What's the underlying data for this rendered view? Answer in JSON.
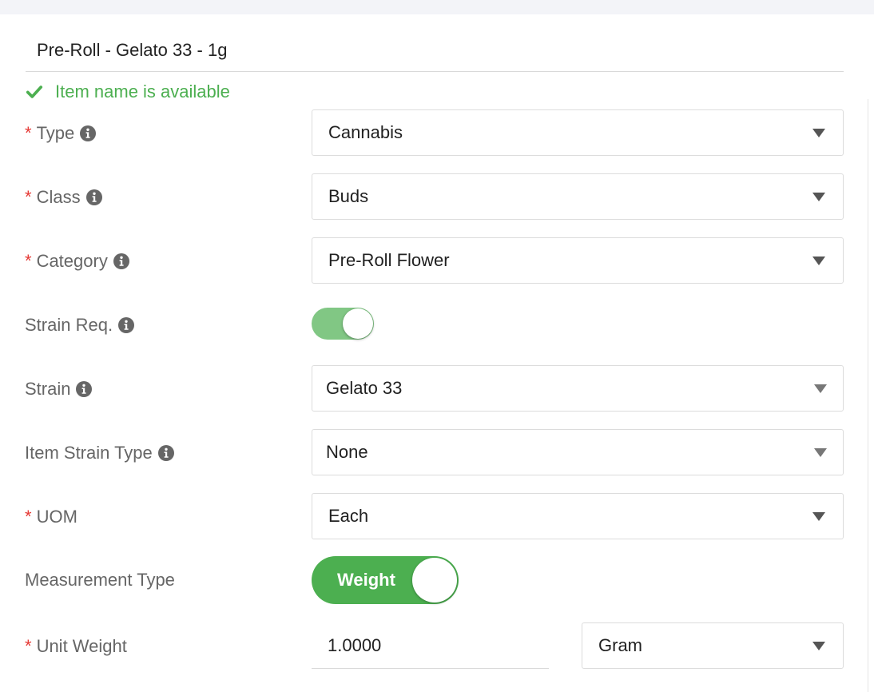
{
  "item_name": {
    "value": "Pre-Roll - Gelato 33 - 1g"
  },
  "availability": {
    "text": "Item name is available",
    "color": "#4caf50"
  },
  "fields": {
    "type": {
      "label": "Type",
      "required": "*",
      "value": "Cannabis"
    },
    "class": {
      "label": "Class",
      "required": "*",
      "value": "Buds"
    },
    "category": {
      "label": "Category",
      "required": "*",
      "value": "Pre-Roll Flower"
    },
    "strain_req": {
      "label": "Strain Req.",
      "toggle_on": true
    },
    "strain": {
      "label": "Strain",
      "value": "Gelato 33"
    },
    "item_strain_type": {
      "label": "Item Strain Type",
      "value": "None"
    },
    "uom": {
      "label": "UOM",
      "required": "*",
      "value": "Each"
    },
    "measurement_type": {
      "label": "Measurement Type",
      "toggle_label": "Weight",
      "toggle_on": true
    },
    "unit_weight": {
      "label": "Unit Weight",
      "required": "*",
      "value": "1.0000",
      "unit": "Gram"
    }
  },
  "icons": {
    "info": "info-circle-icon",
    "check": "check-icon",
    "dropdown": "caret-down-icon"
  },
  "colors": {
    "required": "#e53935",
    "success": "#4caf50",
    "toggle_light": "#81c784"
  }
}
